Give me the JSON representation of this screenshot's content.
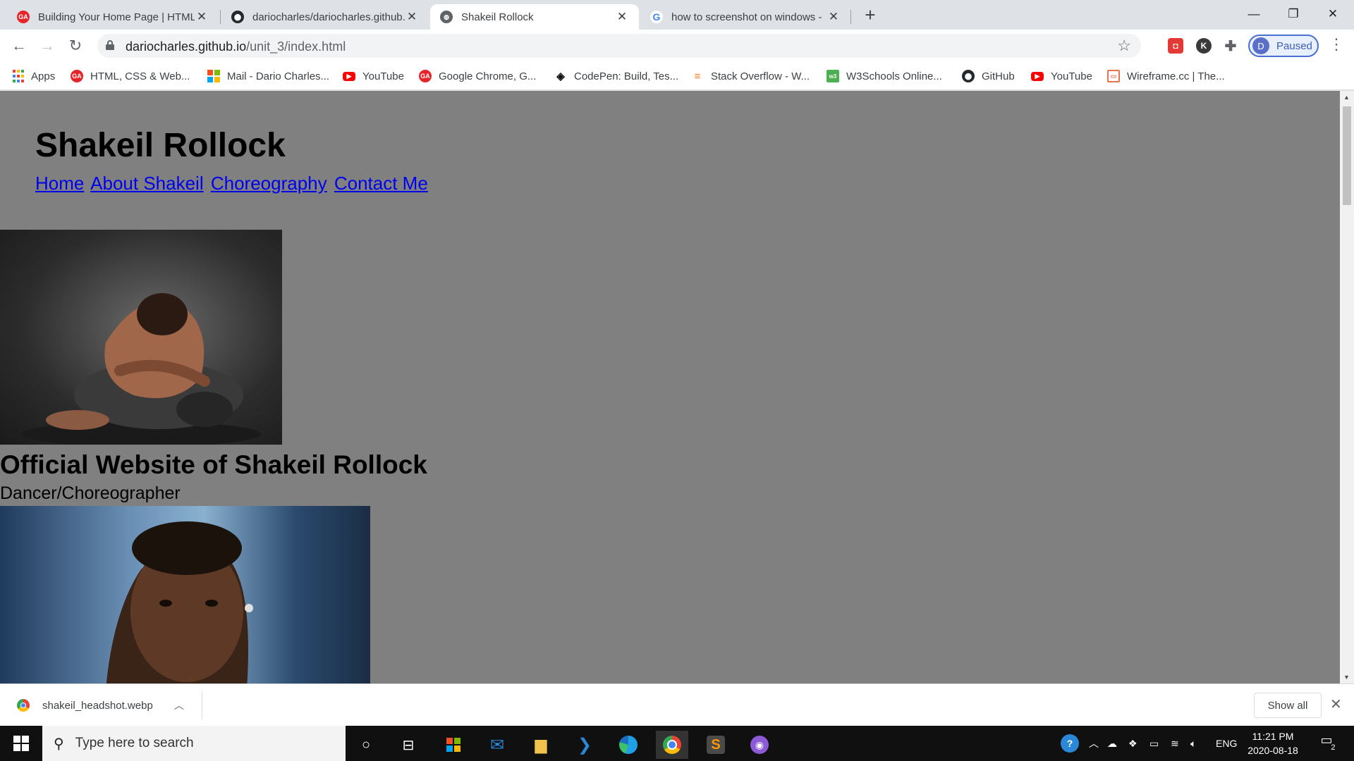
{
  "browser": {
    "tabs": [
      {
        "title": "Building Your Home Page | HTML",
        "favicon": "ga-icon"
      },
      {
        "title": "dariocharles/dariocharles.github.io",
        "favicon": "github-icon"
      },
      {
        "title": "Shakeil Rollock",
        "favicon": "globe-icon",
        "active": true
      },
      {
        "title": "how to screenshot on windows -",
        "favicon": "google-icon"
      }
    ],
    "url_host": "dariocharles.github.io",
    "url_path": "/unit_3/index.html",
    "profile_initial": "D",
    "profile_status": "Paused"
  },
  "bookmarks": [
    {
      "label": "Apps",
      "icon": "apps-grid-icon"
    },
    {
      "label": "HTML, CSS & Web...",
      "icon": "ga-icon"
    },
    {
      "label": "Mail - Dario Charles...",
      "icon": "microsoft-icon"
    },
    {
      "label": "YouTube",
      "icon": "youtube-icon"
    },
    {
      "label": "Google Chrome, G...",
      "icon": "ga-icon"
    },
    {
      "label": "CodePen: Build, Tes...",
      "icon": "codepen-icon"
    },
    {
      "label": "Stack Overflow - W...",
      "icon": "stackoverflow-icon"
    },
    {
      "label": "W3Schools Online...",
      "icon": "w3schools-icon"
    },
    {
      "label": "GitHub",
      "icon": "github-icon"
    },
    {
      "label": "YouTube",
      "icon": "youtube-icon"
    },
    {
      "label": "Wireframe.cc | The...",
      "icon": "wireframe-icon"
    }
  ],
  "page": {
    "title": "Shakeil Rollock",
    "nav": [
      "Home",
      "About Shakeil",
      "Choreography",
      "Contact Me"
    ],
    "headline": "Official Website of Shakeil Rollock",
    "subline": "Dancer/Choreographer"
  },
  "downloads": {
    "file": "shakeil_headshot.webp",
    "show_all": "Show all"
  },
  "taskbar": {
    "search_placeholder": "Type here to search",
    "lang": "ENG",
    "time": "11:21 PM",
    "date": "2020-08-18",
    "notifications": "2"
  },
  "colors": {
    "page_bg": "#808080",
    "link": "#0000ee",
    "taskbar": "#101010"
  }
}
